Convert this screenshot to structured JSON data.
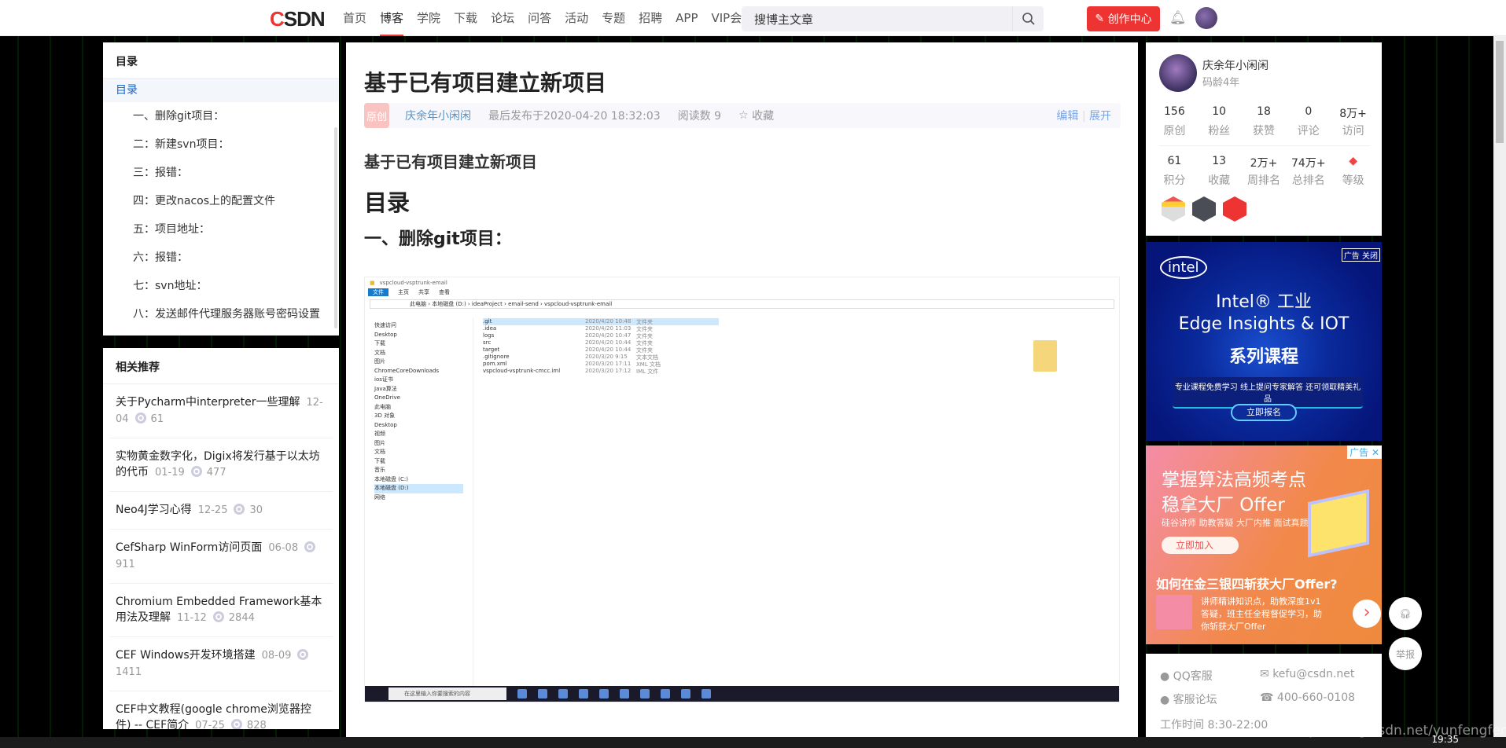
{
  "topbar": {
    "logo_c": "C",
    "logo_rest": "SDN",
    "nav": [
      "首页",
      "博客",
      "学院",
      "下载",
      "论坛",
      "问答",
      "活动",
      "专题",
      "招聘",
      "APP",
      "VIP会员"
    ],
    "active_nav": "博客",
    "search_placeholder": "搜博主文章",
    "create_label": "创作中心"
  },
  "toc": {
    "title": "目录",
    "items": [
      "目录",
      "一、删除git项目：",
      "二：新建svn项目：",
      "三：报错：",
      "四：更改nacos上的配置文件",
      "五：项目地址：",
      "六：报错：",
      "七：svn地址：",
      "八：发送邮件代理服务器账号密码设置"
    ]
  },
  "related": {
    "title": "相关推荐",
    "items": [
      {
        "title": "关于Pycharm中interpreter一些理解",
        "date": "12-04",
        "views": "61"
      },
      {
        "title": "实物黄金数字化，Digix将发行基于以太坊的代币",
        "date": "01-19",
        "views": "477"
      },
      {
        "title": "Neo4J学习心得",
        "date": "12-25",
        "views": "30"
      },
      {
        "title": "CefSharp WinForm访问页面",
        "date": "06-08",
        "views": "911"
      },
      {
        "title": "Chromium Embedded Framework基本用法及理解",
        "date": "11-12",
        "views": "2844"
      },
      {
        "title": "CEF Windows开发环境搭建",
        "date": "08-09",
        "views": "1411"
      },
      {
        "title": "CEF中文教程(google chrome浏览器控件) -- CEF简介",
        "date": "07-25",
        "views": "828"
      }
    ]
  },
  "article": {
    "title": "基于已有项目建立新项目",
    "badge": "原创",
    "author": "庆余年小闲闲",
    "published": "最后发布于2020-04-20 18:32:03",
    "reads": "阅读数 9",
    "favorite": "收藏",
    "edit": "编辑",
    "expand": "展开",
    "h_sub": "基于已有项目建立新项目",
    "h_toc": "目录",
    "h_section": "一、删除git项目："
  },
  "screenshot": {
    "window_title": "vspcloud-vsptrunk-email",
    "ribbon": [
      "文件",
      "主页",
      "共享",
      "查看"
    ],
    "address": "此电脑 › 本地磁盘 (D:) › ideaProject › email-send › vspcloud-vsptrunk-email",
    "nav_items": [
      "快速访问",
      "Desktop",
      "下载",
      "文档",
      "图片",
      "ChromeCoreDownloads",
      "ios证书",
      "Java算法",
      "OneDrive",
      "此电脑",
      "3D 对象",
      "Desktop",
      "视频",
      "图片",
      "文档",
      "下载",
      "音乐",
      "本地磁盘 (C:)",
      "本地磁盘 (D:)",
      "网络"
    ],
    "files": [
      {
        "name": ".git",
        "date": "2020/4/20 10:48",
        "type": "文件夹"
      },
      {
        "name": ".idea",
        "date": "2020/4/20 11:03",
        "type": "文件夹"
      },
      {
        "name": "logs",
        "date": "2020/4/20 10:47",
        "type": "文件夹"
      },
      {
        "name": "src",
        "date": "2020/4/20 10:44",
        "type": "文件夹"
      },
      {
        "name": "target",
        "date": "2020/4/20 10:44",
        "type": "文件夹"
      },
      {
        "name": ".gitignore",
        "date": "2020/3/20 9:15",
        "type": "文本文档"
      },
      {
        "name": "pom.xml",
        "date": "2020/3/20 17:11",
        "type": "XML 文档"
      },
      {
        "name": "vspcloud-vsptrunk-cmcc.iml",
        "date": "2020/3/20 17:12",
        "type": "IML 文件"
      }
    ],
    "taskbar_search": "在这里输入你要搜索的内容"
  },
  "profile": {
    "name": "庆余年小闲闲",
    "age": "码龄4年",
    "stats1": [
      {
        "n": "156",
        "l": "原创"
      },
      {
        "n": "10",
        "l": "粉丝"
      },
      {
        "n": "18",
        "l": "获赞"
      },
      {
        "n": "0",
        "l": "评论"
      },
      {
        "n": "8万+",
        "l": "访问"
      }
    ],
    "stats2": [
      {
        "n": "61",
        "l": "积分"
      },
      {
        "n": "13",
        "l": "收藏"
      },
      {
        "n": "2万+",
        "l": "周排名"
      },
      {
        "n": "74万+",
        "l": "总排名"
      },
      {
        "n": "",
        "l": "等级"
      }
    ]
  },
  "ad1": {
    "tag": "广告 关闭",
    "logo": "intel",
    "line1": "Intel® 工业",
    "line2": "Edge Insights & IOT",
    "line3": "系列课程",
    "line4": "专业课程免费学习  线上提问专家解答  还可领取精美礼品",
    "button": "立即报名"
  },
  "ad2": {
    "tag": "广告 ✕",
    "line1": "掌握算法高频考点",
    "line2": "稳拿大厂 Offer",
    "line3": "硅谷讲师  助教答疑  大厂内推  面试真题",
    "button": "立即加入",
    "headline": "如何在金三银四斩获大厂Offer?",
    "desc": "讲师精讲知识点，助教深度1v1答疑，班主任全程督促学习，助你斩获大厂Offer"
  },
  "contact": {
    "qq": "QQ客服",
    "email": "kefu@csdn.net",
    "forum": "客服论坛",
    "phone": "400-660-0108",
    "hours": "工作时间 8:30-22:00"
  },
  "float": {
    "report": "举报"
  },
  "watermark": "https://blog.csdn.net/yunfengfengfeng",
  "clock": "19:35",
  "colors": {
    "brand": "#e33333",
    "link": "#5893c2"
  }
}
